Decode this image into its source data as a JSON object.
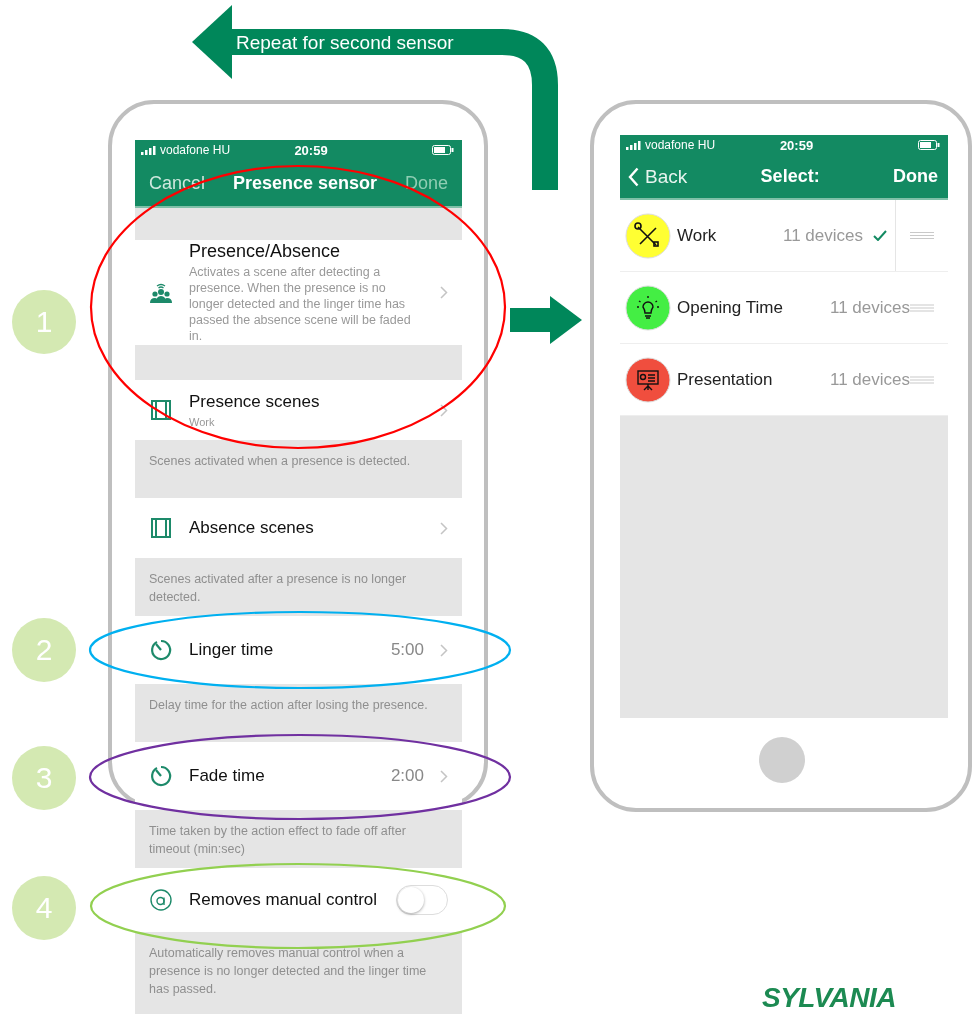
{
  "annotation": {
    "repeat_label": "Repeat for second sensor"
  },
  "steps": [
    {
      "number": "1",
      "color": "#ff0000"
    },
    {
      "number": "2",
      "color": "#00b0f0"
    },
    {
      "number": "3",
      "color": "#7030a0"
    },
    {
      "number": "4",
      "color": "#92d050"
    }
  ],
  "left_phone": {
    "status_bar": {
      "carrier": "vodafone HU",
      "time": "20:59"
    },
    "nav": {
      "cancel": "Cancel",
      "title": "Presence sensor",
      "done": {
        "label": "Done",
        "disabled": true
      }
    },
    "items": [
      {
        "kind": "rich",
        "title": "Presence/Absence",
        "description": "Activates a scene after detecting a presence. When the presence is no longer detected and the linger time has passed the absence scene will be faded in."
      },
      {
        "kind": "nav",
        "title": "Presence scenes",
        "subtitle": "Work"
      },
      {
        "kind": "note",
        "text": "Scenes activated when a presence is detected."
      },
      {
        "kind": "nav",
        "title": "Absence scenes"
      },
      {
        "kind": "note",
        "text": "Scenes activated after a presence is no longer detected."
      },
      {
        "kind": "value",
        "title": "Linger time",
        "value": "5:00"
      },
      {
        "kind": "note",
        "text": "Delay time for the action after losing the presence."
      },
      {
        "kind": "value",
        "title": "Fade time",
        "value": "2:00"
      },
      {
        "kind": "note",
        "text": "Time taken by the action effect to fade off after timeout (min:sec)"
      },
      {
        "kind": "toggle",
        "title": "Removes manual control",
        "on": false
      },
      {
        "kind": "note",
        "text": "Automatically removes manual control when a presence is no longer detected and the linger time has passed."
      }
    ]
  },
  "right_phone": {
    "status_bar": {
      "carrier": "vodafone HU",
      "time": "20:59"
    },
    "nav": {
      "back": "Back",
      "title": "Select:",
      "done": {
        "label": "Done",
        "disabled": false
      }
    },
    "scenes": [
      {
        "name": "Work",
        "devices": "11 devices",
        "color": "#ffff33",
        "selected": true
      },
      {
        "name": "Opening Time",
        "devices": "11 devices",
        "color": "#44ee44",
        "selected": false
      },
      {
        "name": "Presentation",
        "devices": "11 devices",
        "color": "#f04e3e",
        "selected": false
      }
    ]
  },
  "logo": "SYLVANIA"
}
